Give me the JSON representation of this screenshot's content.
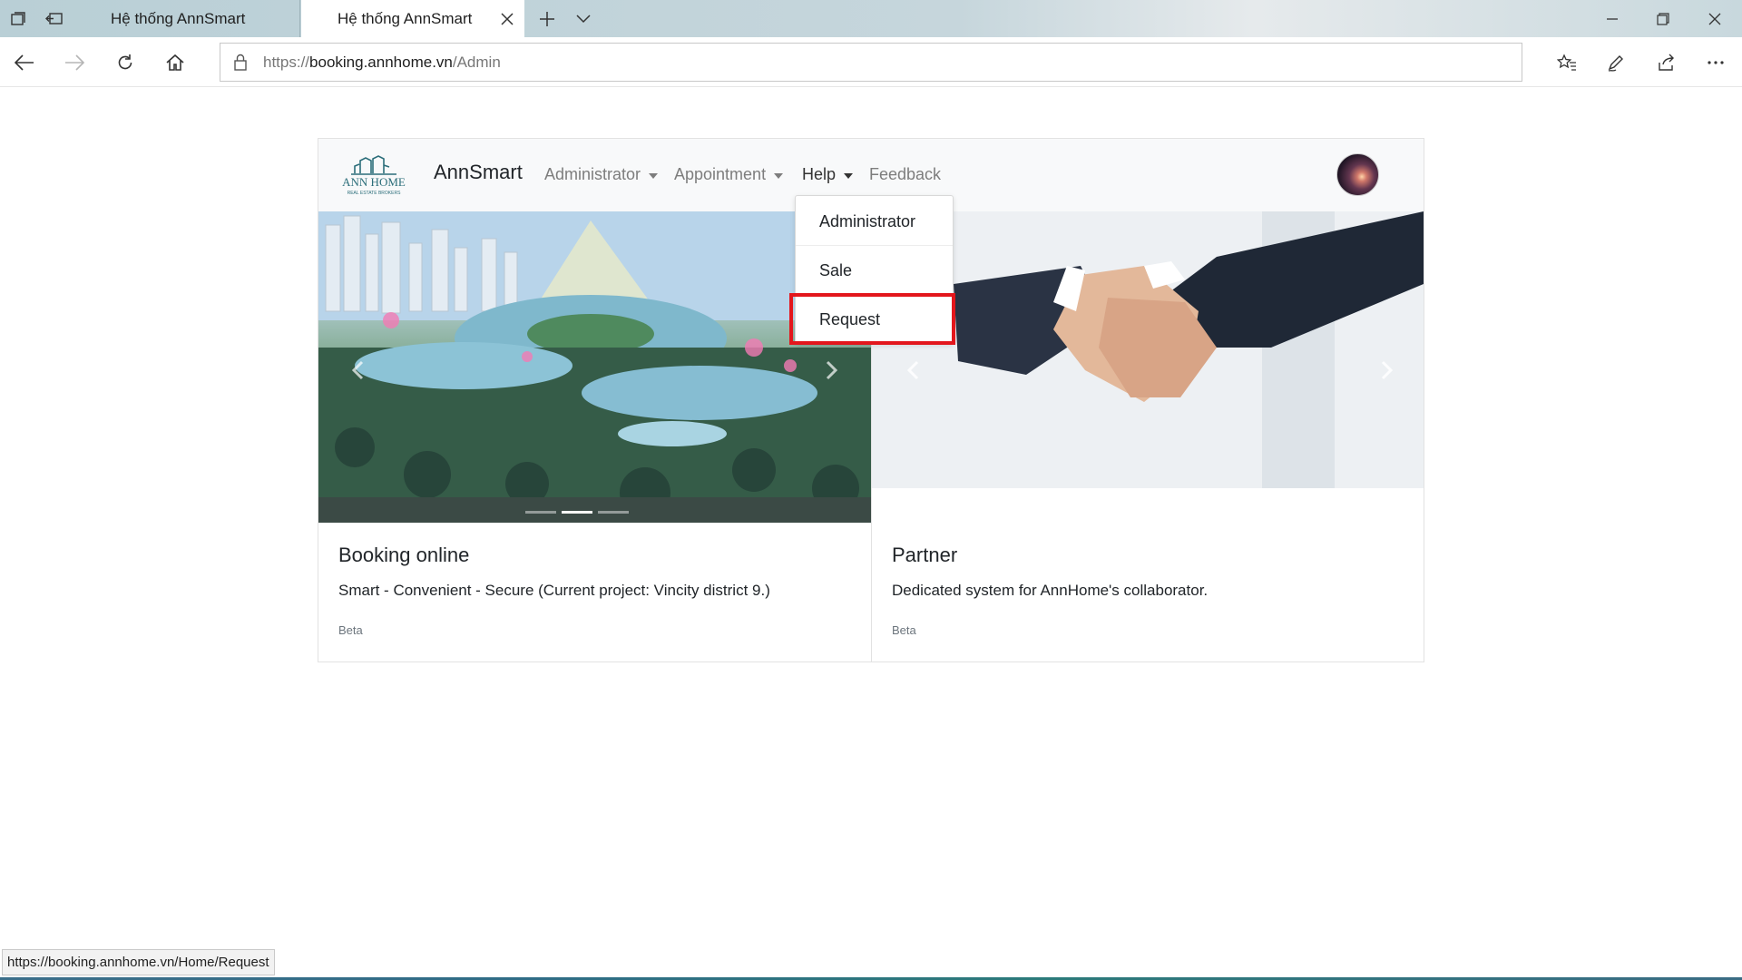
{
  "browser": {
    "tabs": [
      {
        "title": "Hệ thống AnnSmart",
        "active": false
      },
      {
        "title": "Hệ thống AnnSmart",
        "active": true
      }
    ],
    "address": {
      "scheme": "https://",
      "host": "booking.annhome.vn",
      "path": "/Admin"
    },
    "status_url": "https://booking.annhome.vn/Home/Request"
  },
  "site": {
    "brand": "AnnSmart",
    "logo_text": "ANN HOME",
    "logo_subtext": "REAL ESTATE BROKERS",
    "menu": [
      {
        "label": "Administrator",
        "dropdown": true
      },
      {
        "label": "Appointment",
        "dropdown": true
      },
      {
        "label": "Help",
        "dropdown": true,
        "open": true
      },
      {
        "label": "Feedback",
        "dropdown": false
      }
    ],
    "help_dropdown": [
      "Administrator",
      "Sale",
      "Request"
    ],
    "highlighted_item": "Request"
  },
  "cards": [
    {
      "title": "Booking online",
      "text": "Smart - Convenient - Secure (Current project: Vincity district 9.)",
      "badge": "Beta"
    },
    {
      "title": "Partner",
      "text": "Dedicated system for AnnHome's collaborator.",
      "badge": "Beta"
    }
  ],
  "colors": {
    "highlight": "#e3161c",
    "navbar_bg": "#f8f9fa",
    "muted": "#6c757d"
  }
}
